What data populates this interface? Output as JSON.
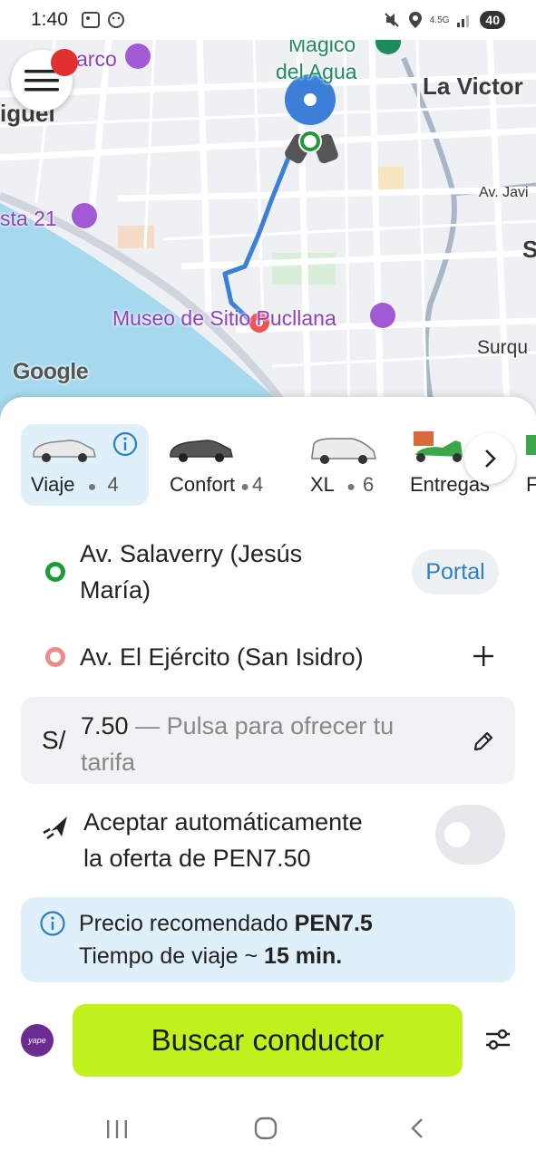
{
  "status_bar": {
    "time": "1:40",
    "network": "4.5G",
    "battery": "40"
  },
  "map": {
    "labels": {
      "magico_line1": "Magico",
      "magico_line2": "del Agua",
      "la_victoria": "La Victor",
      "parque": "Parque del Pa",
      "parque_short": "arco",
      "miguel": "iguel",
      "costa21": "sta 21",
      "museo": "Museo de Sitio Pucllana",
      "surquillo": "Surqu",
      "av_javier": "Av. Javi",
      "s_letter": "S"
    },
    "attribution": "Google"
  },
  "car_options": [
    {
      "label": "Viaje",
      "seats": "4",
      "selected": true
    },
    {
      "label": "Confort",
      "seats": "4",
      "selected": false
    },
    {
      "label": "XL",
      "seats": "6",
      "selected": false
    },
    {
      "label": "Entregas",
      "seats": "",
      "selected": false
    },
    {
      "label": "F",
      "seats": "",
      "selected": false
    }
  ],
  "route": {
    "origin_line1": "Av. Salaverry (Jesús",
    "origin_line2": "María)",
    "portal_label": "Portal",
    "destination": "Av. El Ejército (San Isidro)"
  },
  "fare": {
    "currency": "S/",
    "amount": "7.50",
    "hint_line1": " — Pulsa para ofrecer tu",
    "hint_line2": "tarifa"
  },
  "auto_accept": {
    "line1": "Aceptar automáticamente",
    "line2": "la oferta de PEN7.50",
    "enabled": false
  },
  "recommendation": {
    "price_label": "Precio recomendado ",
    "price_value": "PEN7.5",
    "time_label": "Tiempo de viaje ~ ",
    "time_value": "15 min."
  },
  "payment_badge": "yape",
  "search_button": "Buscar conductor",
  "colors": {
    "accent_green": "#c0f11c",
    "selected_bg": "#dff0fb",
    "route_blue": "#3b7fd9"
  }
}
